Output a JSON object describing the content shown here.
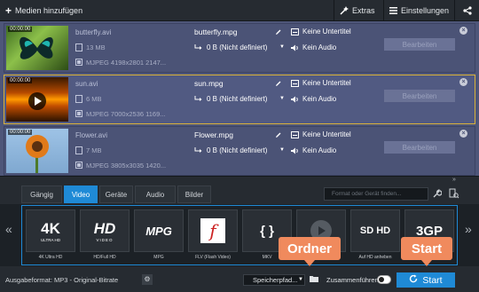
{
  "toolbar": {
    "add_media_label": "Medien hinzufügen",
    "extras_label": "Extras",
    "settings_label": "Einstellungen"
  },
  "files": [
    {
      "duration": "00:00:00",
      "input_name": "butterfly.avi",
      "input_size": "13 MB",
      "input_codec": "MJPEG 4198x2801 2147...",
      "output_name": "butterfly.mpg",
      "output_size": "0 B (Nicht definiert)",
      "subtitles": "Keine Untertitel",
      "audio": "Kein Audio",
      "edit_label": "Bearbeiten",
      "selected": false
    },
    {
      "duration": "00:00:00",
      "input_name": "sun.avi",
      "input_size": "6 MB",
      "input_codec": "MJPEG 7000x2536 1169...",
      "output_name": "sun.mpg",
      "output_size": "0 B (Nicht definiert)",
      "subtitles": "Keine Untertitel",
      "audio": "Kein Audio",
      "edit_label": "Bearbeiten",
      "selected": true
    },
    {
      "duration": "00:00:00",
      "input_name": "Flower.avi",
      "input_size": "7 MB",
      "input_codec": "MJPEG 3805x3035 1420...",
      "output_name": "Flower.mpg",
      "output_size": "0 B (Nicht definiert)",
      "subtitles": "Keine Untertitel",
      "audio": "Kein Audio",
      "edit_label": "Bearbeiten",
      "selected": false
    }
  ],
  "tabs": [
    {
      "label": "Gängig",
      "active": false
    },
    {
      "label": "Video",
      "active": true
    },
    {
      "label": "Geräte",
      "active": false
    },
    {
      "label": "Audio",
      "active": false
    },
    {
      "label": "Bilder",
      "active": false
    }
  ],
  "search": {
    "placeholder": "Format oder Gerät finden..."
  },
  "formats": [
    {
      "logo": "4K",
      "sub": "ULTRA HD",
      "label": "4K Ultra HD"
    },
    {
      "logo": "HD",
      "sub": "VIDEO",
      "label": "HD/Full HD"
    },
    {
      "logo": "MPG",
      "sub": "",
      "label": "MPG"
    },
    {
      "logo": "f",
      "sub": "",
      "label": "FLV (Flash Video)"
    },
    {
      "logo": "{ }",
      "sub": "",
      "label": "MKV"
    },
    {
      "logo": "",
      "sub": "",
      "label": ""
    },
    {
      "logo": "SD HD",
      "sub": "",
      "label": "Auf HD anheben"
    },
    {
      "logo": "3GP",
      "sub": "",
      "label": ""
    }
  ],
  "bottom": {
    "output_format": "Ausgabeformat: MP3 - Original-Bitrate",
    "save_path": "Speicherpfad...",
    "merge_label": "Zusammenführen",
    "start_label": "Start"
  },
  "callouts": {
    "folder": "Ordner",
    "start": "Start"
  },
  "colors": {
    "accent": "#1f8ad6",
    "callout": "#f08a5d",
    "selection": "#d9b23a",
    "list_bg": "#4e5679"
  }
}
